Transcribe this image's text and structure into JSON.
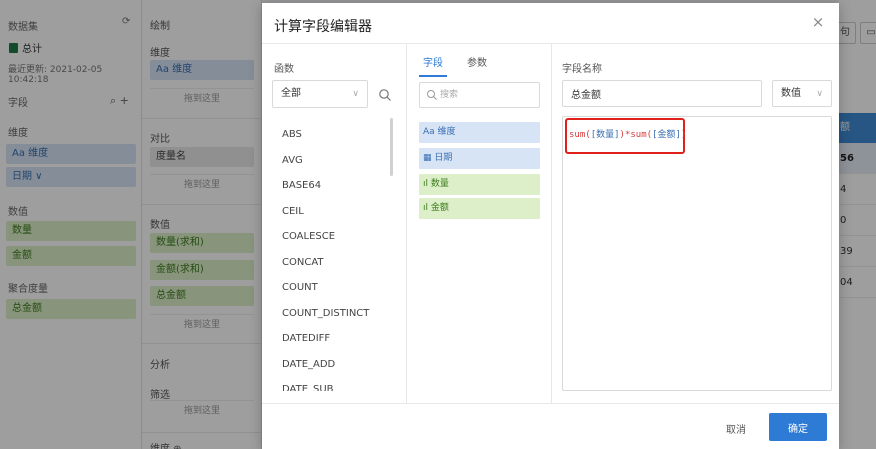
{
  "background": {
    "dataset": {
      "header": "数据集",
      "table_name": "总计",
      "last_update": "最近更新: 2021-02-05 10:42:18",
      "fields_label": "字段",
      "dimension_label": "维度",
      "dimension_items": [
        "Aa 维度",
        "日期 ∨"
      ],
      "measure_label": "数值",
      "measure_items": [
        "数量",
        "金额"
      ],
      "agg_label": "聚合度量",
      "agg_items": [
        "总金额"
      ]
    },
    "config": {
      "draw_label": "绘制",
      "dim_label": "维度",
      "dim_chip": "Aa 维度",
      "drop_hint": "拖到这里",
      "compare_label": "对比",
      "compare_chip": "度量名",
      "value_label": "数值",
      "value_chips": [
        "数量(求和)",
        "金额(求和)",
        "总金额"
      ],
      "analysis_label": "分析",
      "filter_label": "筛选",
      "bottom_label": "维度 ⊕"
    },
    "right": {
      "btn_label": "句",
      "column_header": "额",
      "cells": [
        "56",
        "4",
        "0",
        "39",
        "04"
      ]
    }
  },
  "modal": {
    "title": "计算字段编辑器",
    "close_label": "×",
    "function_col": {
      "title": "函数",
      "category_selected": "全部",
      "functions": [
        "ABS",
        "AVG",
        "BASE64",
        "CEIL",
        "COALESCE",
        "CONCAT",
        "COUNT",
        "COUNT_DISTINCT",
        "DATEDIFF",
        "DATE_ADD",
        "DATE_SUB"
      ]
    },
    "field_col": {
      "tabs": [
        "字段",
        "参数"
      ],
      "search_placeholder": "搜索",
      "fields": [
        {
          "label": "Aa 维度",
          "kind": "dimension"
        },
        {
          "label": "日期",
          "kind": "dimension"
        },
        {
          "label": "数量",
          "kind": "measure"
        },
        {
          "label": "金额",
          "kind": "measure"
        }
      ]
    },
    "editor_col": {
      "title": "字段名称",
      "field_name": "总金额",
      "type_selected": "数值",
      "formula_prefix": "sum(",
      "formula_field1": "[数量]",
      "formula_mid": ")*sum(",
      "formula_field2": "[金额]",
      "formula_suffix": ")"
    },
    "footer": {
      "cancel_label": "取消",
      "ok_label": "确定"
    }
  }
}
